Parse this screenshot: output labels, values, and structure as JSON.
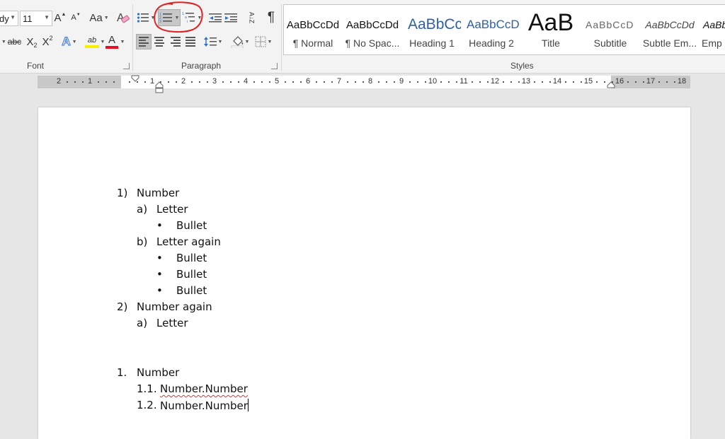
{
  "ribbon": {
    "font_name": "dy",
    "font_size": "11",
    "grow_font": "A",
    "shrink_font": "A",
    "change_case": "Aa",
    "strike": "abc",
    "subscript": "X",
    "subscript_mark": "2",
    "superscript": "X",
    "superscript_mark": "2",
    "text_effects": "A",
    "highlight": "ab",
    "font_color": "A",
    "sort": "A↓Z",
    "show_marks": "¶",
    "groups": {
      "font": "Font",
      "paragraph": "Paragraph",
      "styles": "Styles"
    },
    "colors": {
      "highlight": "#f6f000",
      "font_color": "#e81123",
      "annotation": "#e02020"
    }
  },
  "styles": [
    {
      "preview": "AaBbCcDd",
      "name": "¶ Normal"
    },
    {
      "preview": "AaBbCcDd",
      "name": "¶ No Spac..."
    },
    {
      "preview": "AaBbCc",
      "name": "Heading 1"
    },
    {
      "preview": "AaBbCcD",
      "name": "Heading 2"
    },
    {
      "preview": "AaB",
      "name": "Title"
    },
    {
      "preview": "AaBbCcD",
      "name": "Subtitle"
    },
    {
      "preview": "AaBbCcDd",
      "name": "Subtle Em..."
    },
    {
      "preview": "AaBbCcDd",
      "name": "Emp"
    }
  ],
  "ruler": {
    "left_labels": [
      "2",
      "1"
    ],
    "right_labels": [
      "1",
      "2",
      "3",
      "4",
      "5",
      "6",
      "7",
      "8",
      "9",
      "10",
      "11",
      "12",
      "13",
      "14",
      "15",
      "16",
      "17",
      "18"
    ]
  },
  "document": {
    "list1": [
      {
        "marker": "1)",
        "text": "Number"
      },
      {
        "marker": "a)",
        "text": "Letter"
      },
      {
        "marker": "•",
        "text": "Bullet"
      },
      {
        "marker": "b)",
        "text": "Letter again"
      },
      {
        "marker": "•",
        "text": "Bullet"
      },
      {
        "marker": "•",
        "text": "Bullet"
      },
      {
        "marker": "•",
        "text": "Bullet"
      },
      {
        "marker": "2)",
        "text": "Number again"
      },
      {
        "marker": "a)",
        "text": "Letter"
      }
    ],
    "list2": [
      {
        "marker": "1.",
        "text": "Number"
      },
      {
        "marker": "1.1.",
        "text": "Number.Number"
      },
      {
        "marker": "1.2.",
        "text": "Number.Number"
      }
    ]
  }
}
